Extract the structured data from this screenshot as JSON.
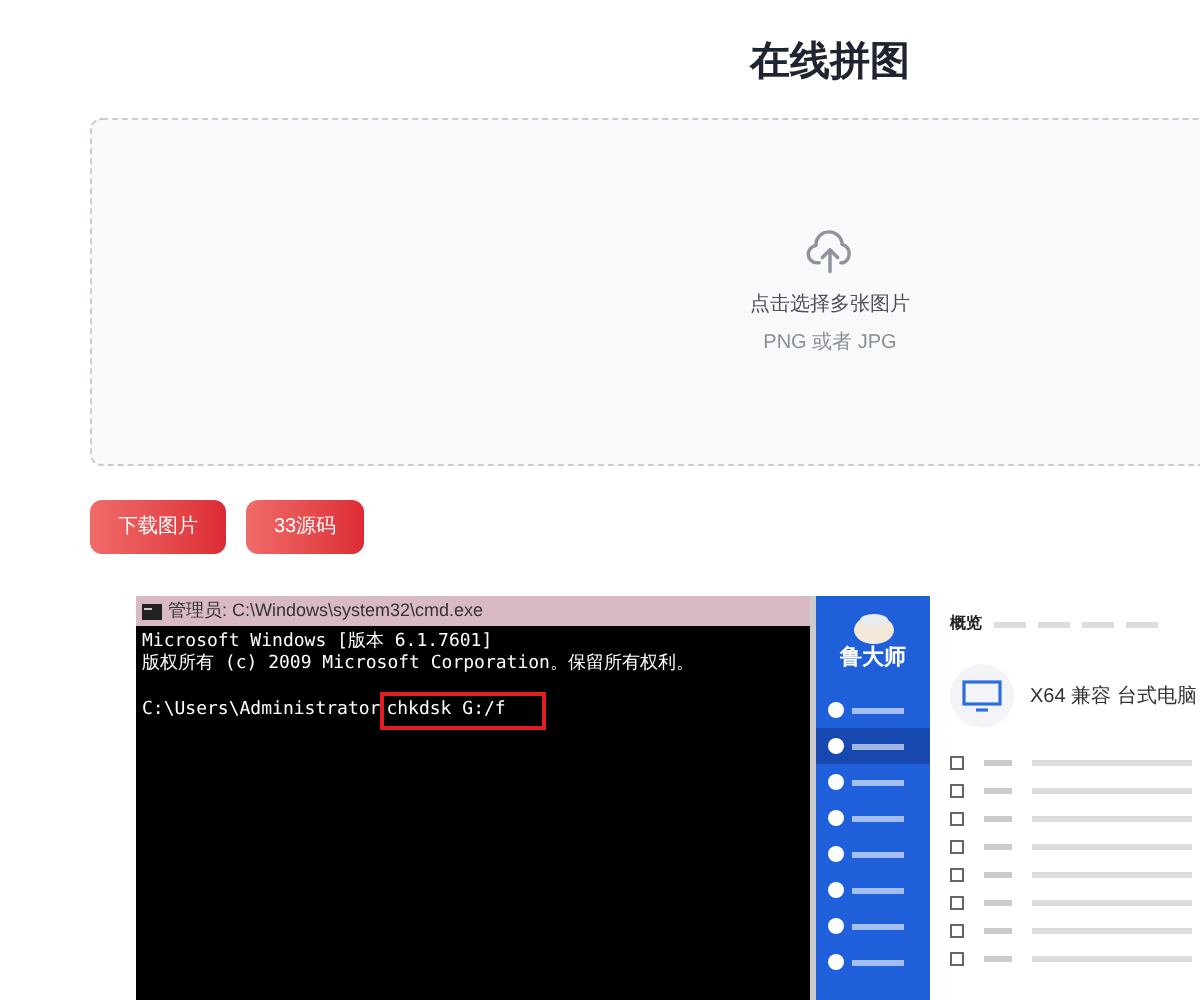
{
  "title": "在线拼图",
  "upload": {
    "label": "点击选择多张图片",
    "hint": "PNG 或者 JPG"
  },
  "buttons": [
    "下载图片",
    "33源码"
  ],
  "image": {
    "cmd": {
      "title": "管理员: C:\\Windows\\system32\\cmd.exe",
      "lines": [
        "Microsoft Windows [版本 6.1.7601]",
        "版权所有 (c) 2009 Microsoft Corporation。保留所有权利。"
      ],
      "prompt": "C:\\Users\\Administrator",
      "command": "chkdsk G:/f"
    },
    "app": {
      "brand": "鲁大师",
      "sidebar_items": [
        {
          "selected": false
        },
        {
          "selected": true
        },
        {
          "selected": false
        },
        {
          "selected": false
        },
        {
          "selected": false
        },
        {
          "selected": false
        },
        {
          "selected": false
        },
        {
          "selected": false
        }
      ],
      "tabs": [
        {
          "label": "概览",
          "selected": true
        }
      ],
      "device": "X64 兼容 台式电脑"
    }
  }
}
